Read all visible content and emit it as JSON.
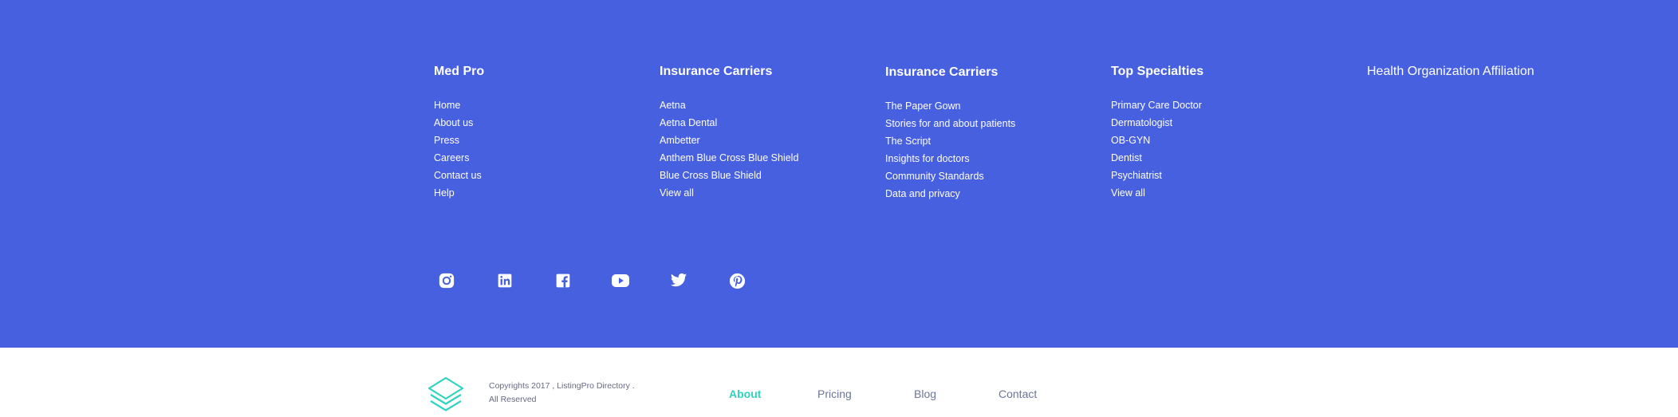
{
  "columns": [
    {
      "title": "Med Pro",
      "items": [
        "Home",
        "About us",
        "Press",
        "Careers",
        "Contact us",
        "Help"
      ]
    },
    {
      "title": "Insurance Carriers",
      "items": [
        "Aetna",
        "Aetna Dental",
        "Ambetter",
        "Anthem Blue Cross Blue Shield",
        "Blue Cross Blue Shield",
        "View all"
      ]
    },
    {
      "title": "Insurance Carriers",
      "items": [
        "The Paper Gown",
        "Stories for and about patients",
        "The Script",
        "Insights for doctors",
        "Community Standards",
        "Data and privacy"
      ]
    },
    {
      "title": "Top Specialties",
      "items": [
        "Primary Care Doctor",
        "Dermatologist",
        "OB-GYN",
        "Dentist",
        "Psychiatrist",
        "View all"
      ]
    },
    {
      "title": "Health Organization Affiliation",
      "items": []
    }
  ],
  "socials": [
    "instagram-icon",
    "linkedin-icon",
    "facebook-icon",
    "youtube-icon",
    "twitter-icon",
    "pinterest-icon"
  ],
  "bottom": {
    "copyright_line1": "Copyrights 2017 , ListingPro Directory .",
    "copyright_line2": "All Reserved",
    "nav": [
      "About",
      "Pricing",
      "Blog",
      "Contact"
    ]
  },
  "colors": {
    "primary": "#4760e0",
    "accent": "#2fd3be",
    "muted": "#6b7797"
  }
}
